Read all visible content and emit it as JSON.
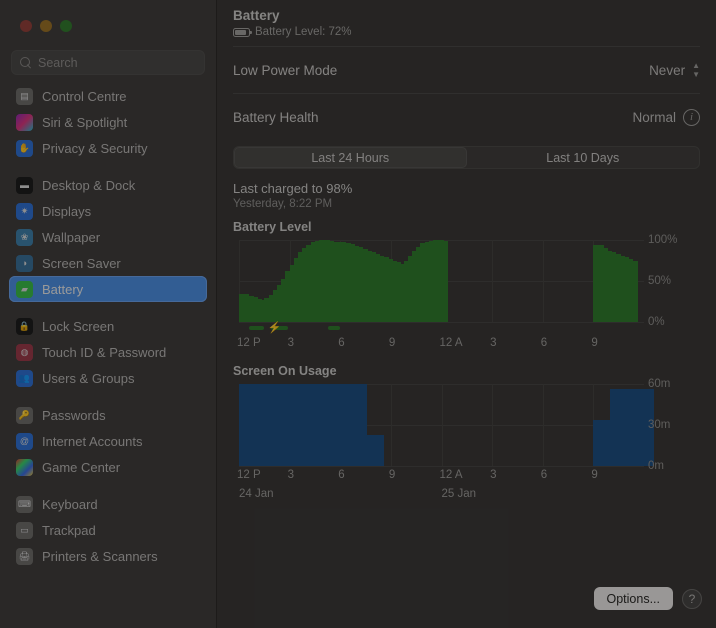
{
  "window": {
    "traffic_lights": [
      "close",
      "minimize",
      "zoom"
    ]
  },
  "search": {
    "placeholder": "Search",
    "value": ""
  },
  "sidebar": {
    "items": [
      {
        "label": "Control Centre",
        "icon": "control-centre-icon",
        "group": 0,
        "selected": false
      },
      {
        "label": "Siri & Spotlight",
        "icon": "siri-icon",
        "group": 0,
        "selected": false
      },
      {
        "label": "Privacy & Security",
        "icon": "privacy-icon",
        "group": 0,
        "selected": false
      },
      {
        "label": "Desktop & Dock",
        "icon": "desktop-dock-icon",
        "group": 1,
        "selected": false
      },
      {
        "label": "Displays",
        "icon": "displays-icon",
        "group": 1,
        "selected": false
      },
      {
        "label": "Wallpaper",
        "icon": "wallpaper-icon",
        "group": 1,
        "selected": false
      },
      {
        "label": "Screen Saver",
        "icon": "screen-saver-icon",
        "group": 1,
        "selected": false
      },
      {
        "label": "Battery",
        "icon": "battery-icon",
        "group": 1,
        "selected": true
      },
      {
        "label": "Lock Screen",
        "icon": "lock-screen-icon",
        "group": 2,
        "selected": false
      },
      {
        "label": "Touch ID & Password",
        "icon": "touch-id-icon",
        "group": 2,
        "selected": false
      },
      {
        "label": "Users & Groups",
        "icon": "users-groups-icon",
        "group": 2,
        "selected": false
      },
      {
        "label": "Passwords",
        "icon": "passwords-icon",
        "group": 3,
        "selected": false
      },
      {
        "label": "Internet Accounts",
        "icon": "internet-accounts-icon",
        "group": 3,
        "selected": false
      },
      {
        "label": "Game Center",
        "icon": "game-center-icon",
        "group": 3,
        "selected": false
      },
      {
        "label": "Keyboard",
        "icon": "keyboard-icon",
        "group": 4,
        "selected": false
      },
      {
        "label": "Trackpad",
        "icon": "trackpad-icon",
        "group": 4,
        "selected": false
      },
      {
        "label": "Printers & Scanners",
        "icon": "printers-icon",
        "group": 4,
        "selected": false
      }
    ]
  },
  "header": {
    "title": "Battery",
    "subtitle": "Battery Level: 72%",
    "battery_icon": "battery-level-icon"
  },
  "settings": {
    "low_power_mode": {
      "label": "Low Power Mode",
      "value": "Never",
      "control": "popup-menu"
    },
    "battery_health": {
      "label": "Battery Health",
      "value": "Normal",
      "info": "info-icon"
    }
  },
  "segmented": {
    "options": [
      "Last 24 Hours",
      "Last 10 Days"
    ],
    "selected_index": 0
  },
  "last_charge": {
    "headline": "Last charged to 98%",
    "timestamp": "Yesterday, 8:22 PM"
  },
  "footer": {
    "options_label": "Options...",
    "help_label": "?"
  },
  "chart_data": [
    {
      "type": "bar",
      "title": "Battery Level",
      "xlabel": "",
      "ylabel": "",
      "ylim": [
        0,
        100
      ],
      "ytick_labels": [
        "100%",
        "50%",
        "0%"
      ],
      "ytick_values": [
        100,
        50,
        0
      ],
      "xtick_labels": [
        "12 P",
        "3",
        "6",
        "9",
        "12 A",
        "3",
        "6",
        "9"
      ],
      "xtick_hours": [
        0,
        3,
        6,
        9,
        12,
        15,
        18,
        21
      ],
      "x_range_hours": [
        0,
        24
      ],
      "grid": true,
      "bar_color": "#2f7a2c",
      "x": [
        0.0,
        0.25,
        0.5,
        0.75,
        1.0,
        1.25,
        1.5,
        1.75,
        2.0,
        2.25,
        2.5,
        2.75,
        3.0,
        3.25,
        3.5,
        3.75,
        4.0,
        4.25,
        4.5,
        4.75,
        5.0,
        5.25,
        5.5,
        5.75,
        6.0,
        6.25,
        6.5,
        6.75,
        7.0,
        7.25,
        7.5,
        7.75,
        8.0,
        8.25,
        8.5,
        8.75,
        9.0,
        9.25,
        9.5,
        9.75,
        10.0,
        10.25,
        10.5,
        10.75,
        11.0,
        11.25,
        11.5,
        11.75,
        21.0,
        21.25,
        21.5,
        21.75,
        22.0,
        22.25,
        22.5,
        22.75,
        23.0
      ],
      "values": [
        34,
        32,
        30,
        28,
        27,
        26,
        29,
        33,
        39,
        45,
        53,
        62,
        70,
        78,
        85,
        90,
        94,
        97,
        99,
        100,
        99,
        98,
        97,
        97,
        96,
        95,
        93,
        91,
        89,
        87,
        85,
        83,
        81,
        79,
        77,
        75,
        73,
        71,
        70,
        74,
        80,
        86,
        92,
        96,
        98,
        99,
        100,
        99,
        94,
        90,
        87,
        85,
        83,
        81,
        79,
        77,
        74
      ],
      "charging_periods": [
        {
          "start_hour": 0.6,
          "end_hour": 1.5
        },
        {
          "start_hour": 1.9,
          "end_hour": 2.9
        },
        {
          "start_hour": 5.3,
          "end_hour": 6.0
        }
      ],
      "charging_bolt_hour": 1.7
    },
    {
      "type": "bar",
      "title": "Screen On Usage",
      "xlabel": "",
      "ylabel": "",
      "ylim": [
        0,
        60
      ],
      "ytick_labels": [
        "60m",
        "30m",
        "0m"
      ],
      "ytick_values": [
        60,
        30,
        0
      ],
      "xtick_labels": [
        "12 P",
        "3",
        "6",
        "9",
        "12 A",
        "3",
        "6",
        "9"
      ],
      "xtick_hours": [
        0,
        3,
        6,
        9,
        12,
        15,
        18,
        21
      ],
      "day_labels": [
        {
          "label": "24 Jan",
          "hour": 0
        },
        {
          "label": "25 Jan",
          "hour": 12
        }
      ],
      "x_range_hours": [
        0,
        24
      ],
      "grid": true,
      "bar_color": "#1d4e80",
      "x": [
        0,
        1,
        2,
        3,
        4,
        5,
        6,
        21,
        22
      ],
      "values": [
        60,
        38,
        60,
        60,
        60,
        60,
        23,
        34,
        56
      ]
    }
  ]
}
